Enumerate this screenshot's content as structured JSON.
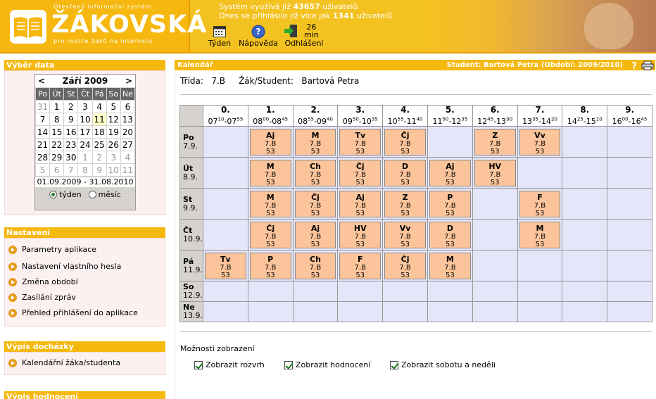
{
  "header": {
    "logo_sup": "Otevřený informační systém",
    "logo_title": "ŽÁKOVSKÁ",
    "logo_sub": "pro rodiče žáků na internetu",
    "info_line1_prefix": "Systém využívá již",
    "info_line1_count": "43657",
    "info_line1_suffix": "uživatelů",
    "info_line2_prefix": "Dnes se přihlásilo již více jak",
    "info_line2_count": "1341",
    "info_line2_suffix": "uživatelů",
    "toolbar": [
      {
        "label": "Týden",
        "icon": "calendar-week-icon"
      },
      {
        "label": "Nápověda",
        "icon": "help-icon"
      },
      {
        "label": "Odhlášení",
        "icon": "logout-icon"
      }
    ],
    "session_minutes": "26",
    "session_unit": "min"
  },
  "sidebar": {
    "vyber_title": "Výběr data",
    "calendar": {
      "prev": "<",
      "next": ">",
      "month": "Září 2009",
      "weekdays": [
        "Po",
        "Út",
        "St",
        "Čt",
        "Pá",
        "So",
        "Ne"
      ],
      "weeks": [
        [
          "31",
          "1",
          "2",
          "3",
          "4",
          "5",
          "6"
        ],
        [
          "7",
          "8",
          "9",
          "10",
          "11",
          "12",
          "13"
        ],
        [
          "14",
          "15",
          "16",
          "17",
          "18",
          "19",
          "20"
        ],
        [
          "21",
          "22",
          "23",
          "24",
          "25",
          "26",
          "27"
        ],
        [
          "28",
          "29",
          "30",
          "1",
          "2",
          "3",
          "4"
        ],
        [
          "5",
          "6",
          "7",
          "8",
          "9",
          "10",
          "11"
        ]
      ],
      "today": "11",
      "range": "01.09.2009 - 31.08.2010",
      "radio_week": "týden",
      "radio_month": "měsíc"
    },
    "nastaveni_title": "Nastavení",
    "nastaveni_items": [
      "Parametry aplikace",
      "Nastavení vlastního hesla",
      "Změna období",
      "Zasílání zpráv",
      "Přehled přihlášení do aplikace"
    ],
    "dochazka_title": "Výpis docházky",
    "dochazka_items": [
      "Kalendářní žáka/studenta"
    ],
    "hodnoceni_title": "Výpis hodnocení"
  },
  "main": {
    "title": "Kalendář",
    "student_info": "Student: Bartová Petra  (Období: 2009/2010)",
    "trida_label": "Třída:",
    "trida_value": "7.B",
    "student_label": "Žák/Student:",
    "student_value": "Bartová Petra",
    "periods": [
      {
        "num": "0.",
        "s": "07",
        "ss": "10",
        "e": "07",
        "es": "55"
      },
      {
        "num": "1.",
        "s": "08",
        "ss": "00",
        "e": "08",
        "es": "45"
      },
      {
        "num": "2.",
        "s": "08",
        "ss": "55",
        "e": "09",
        "es": "40"
      },
      {
        "num": "3.",
        "s": "09",
        "ss": "50",
        "e": "10",
        "es": "35"
      },
      {
        "num": "4.",
        "s": "10",
        "ss": "55",
        "e": "11",
        "es": "40"
      },
      {
        "num": "5.",
        "s": "11",
        "ss": "50",
        "e": "12",
        "es": "35"
      },
      {
        "num": "6.",
        "s": "12",
        "ss": "45",
        "e": "13",
        "es": "30"
      },
      {
        "num": "7.",
        "s": "13",
        "ss": "35",
        "e": "14",
        "es": "20"
      },
      {
        "num": "8.",
        "s": "14",
        "ss": "25",
        "e": "15",
        "es": "10"
      },
      {
        "num": "9.",
        "s": "16",
        "ss": "00",
        "e": "16",
        "es": "45"
      }
    ],
    "days": [
      {
        "name": "Po",
        "date": "7.9.",
        "lessons": [
          "",
          "Aj",
          "M",
          "Tv",
          "Čj",
          "",
          "Z",
          "Vv",
          "",
          ""
        ]
      },
      {
        "name": "Út",
        "date": "8.9.",
        "lessons": [
          "",
          "M",
          "Ch",
          "Čj",
          "D",
          "Aj",
          "HV",
          "",
          "",
          ""
        ]
      },
      {
        "name": "St",
        "date": "9.9.",
        "lessons": [
          "",
          "M",
          "Čj",
          "Aj",
          "Z",
          "P",
          "",
          "F",
          "",
          ""
        ]
      },
      {
        "name": "Čt",
        "date": "10.9.",
        "lessons": [
          "",
          "Čj",
          "Aj",
          "HV",
          "Vv",
          "D",
          "",
          "M",
          "",
          ""
        ]
      },
      {
        "name": "Pá",
        "date": "11.9.",
        "lessons": [
          "Tv",
          "P",
          "Ch",
          "F",
          "Čj",
          "M",
          "",
          "",
          "",
          ""
        ]
      },
      {
        "name": "So",
        "date": "12.9.",
        "lessons": [
          "",
          "",
          "",
          "",
          "",
          "",
          "",
          "",
          "",
          ""
        ]
      },
      {
        "name": "Ne",
        "date": "13.9.",
        "lessons": [
          "",
          "",
          "",
          "",
          "",
          "",
          "",
          "",
          "",
          ""
        ]
      }
    ],
    "lesson_class": "7.B",
    "lesson_room": "53",
    "options_title": "Možnosti zobrazení",
    "options": [
      "Zobrazit rozvrh",
      "Zobrazit hodnocení",
      "Zobrazit sobotu a neděli"
    ]
  }
}
